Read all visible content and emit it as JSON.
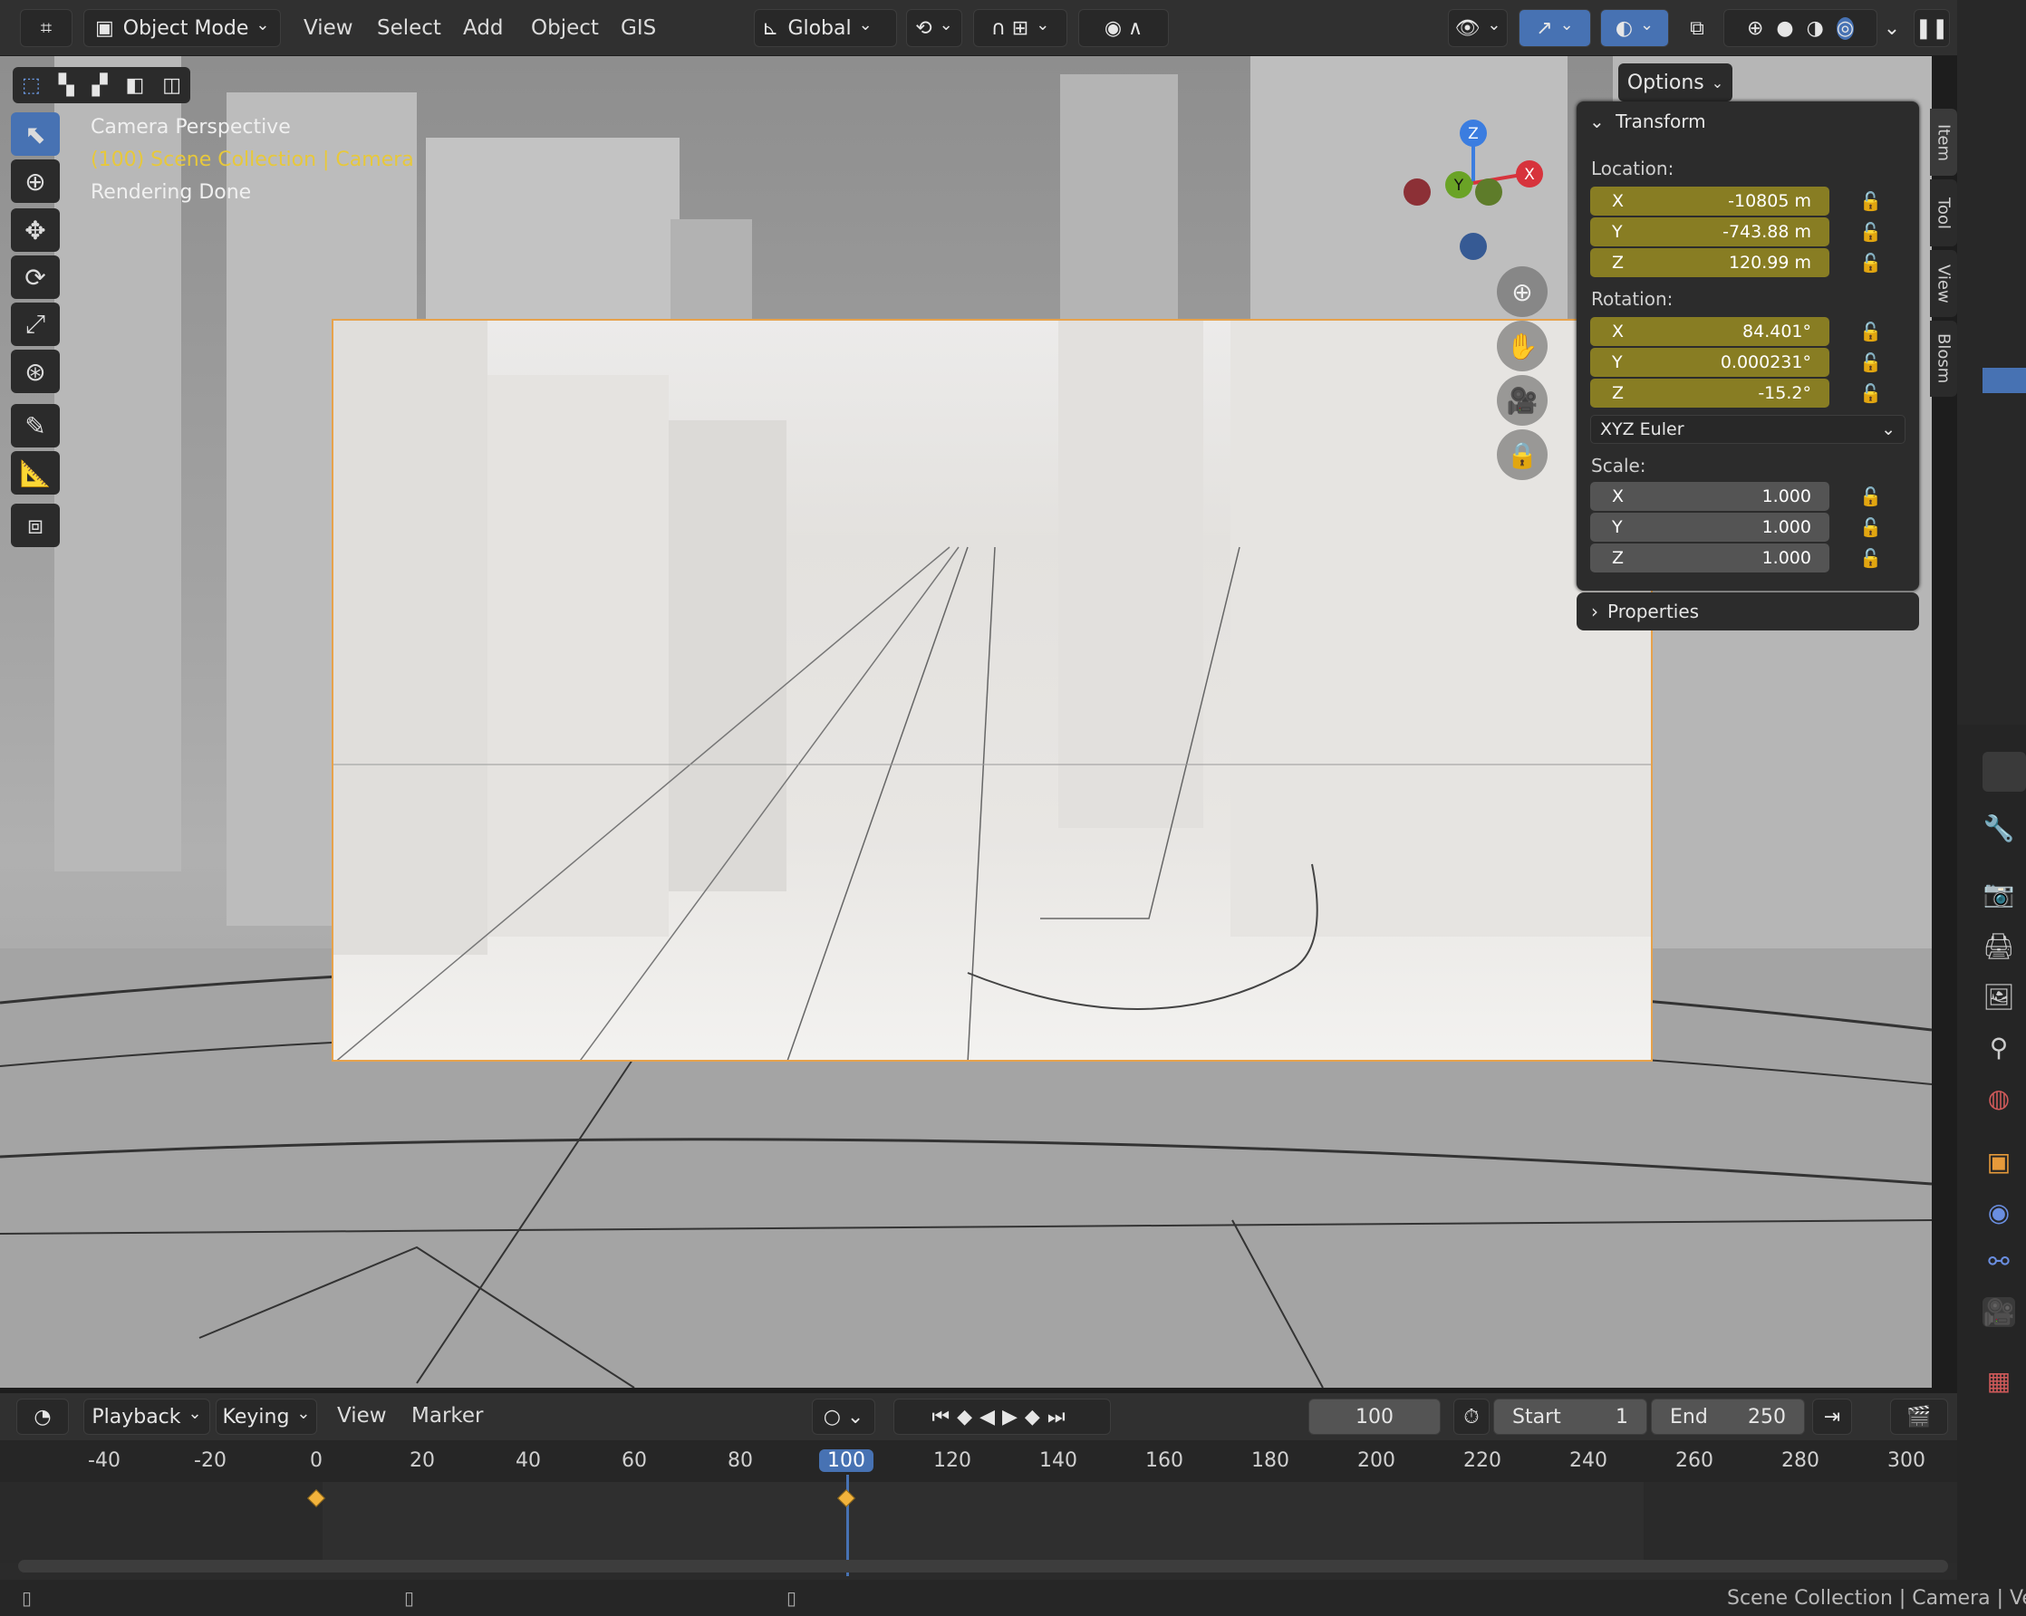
{
  "header": {
    "mode": "Object Mode",
    "menus": [
      "View",
      "Select",
      "Add",
      "Object",
      "GIS"
    ],
    "orientation": "Global"
  },
  "viewport": {
    "options_label": "Options",
    "overlay_lines": [
      "Camera Perspective",
      "(100) Scene Collection | Camera",
      "Rendering Done"
    ],
    "gizmo_axes": [
      "Z",
      "Y",
      "X"
    ]
  },
  "npanel": {
    "transform_title": "Transform",
    "location_label": "Location:",
    "location": [
      {
        "axis": "X",
        "value": "-10805 m"
      },
      {
        "axis": "Y",
        "value": "-743.88 m"
      },
      {
        "axis": "Z",
        "value": "120.99 m"
      }
    ],
    "rotation_label": "Rotation:",
    "rotation": [
      {
        "axis": "X",
        "value": "84.401°"
      },
      {
        "axis": "Y",
        "value": "0.000231°"
      },
      {
        "axis": "Z",
        "value": "-15.2°"
      }
    ],
    "rotation_mode": "XYZ Euler",
    "scale_label": "Scale:",
    "scale": [
      {
        "axis": "X",
        "value": "1.000"
      },
      {
        "axis": "Y",
        "value": "1.000"
      },
      {
        "axis": "Z",
        "value": "1.000"
      }
    ],
    "properties_title": "Properties",
    "tabs": [
      "Item",
      "Tool",
      "View",
      "Blosm"
    ]
  },
  "timeline": {
    "menus": [
      "Playback",
      "Keying",
      "View",
      "Marker"
    ],
    "current_frame": "100",
    "start_label": "Start",
    "start_value": "1",
    "end_label": "End",
    "end_value": "250",
    "ticks": [
      "-40",
      "-20",
      "0",
      "20",
      "40",
      "60",
      "80",
      "100",
      "120",
      "140",
      "160",
      "180",
      "200",
      "220",
      "240",
      "260",
      "280",
      "300"
    ],
    "keyframes": [
      "0",
      "100"
    ]
  },
  "statusbar": {
    "text": "Scene Collection | Camera | Ver"
  },
  "colors": {
    "accent": "#4772b3",
    "field_yellow": "#887d23",
    "overlay_yellow": "#e7c83b",
    "camera_frame": "#e7a24b"
  }
}
